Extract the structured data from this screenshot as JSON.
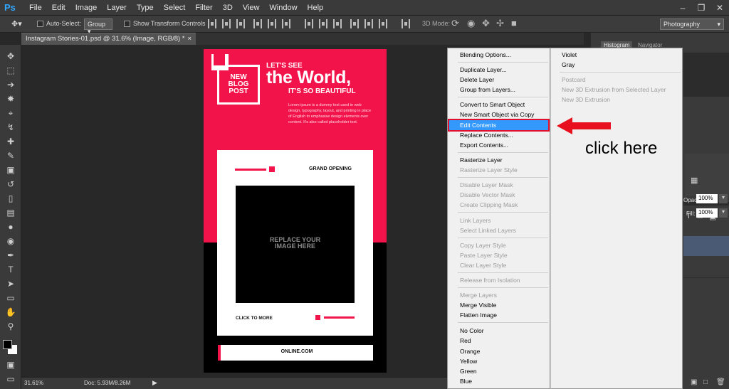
{
  "app": {
    "logo": "Ps"
  },
  "menu": [
    "File",
    "Edit",
    "Image",
    "Layer",
    "Type",
    "Select",
    "Filter",
    "3D",
    "View",
    "Window",
    "Help"
  ],
  "options_bar": {
    "auto_select_label": "Auto-Select:",
    "auto_select_value": "Group",
    "transform_controls_label": "Show Transform Controls",
    "mode_3d_label": "3D Mode:",
    "workspace": "Photography"
  },
  "document": {
    "tab_title": "Instagram Stories-01.psd @ 31.6% (Image, RGB/8) *"
  },
  "poster": {
    "logo_lines": [
      "NEW",
      "BLOG",
      "POST"
    ],
    "headline_top": "LET'S SEE",
    "headline_main": "the World,",
    "headline_sub": "IT'S SO BEAUTIFUL",
    "body_copy": "Lorem ipsum is a dummy text used in web design, typography, layout, and printing in place of English to emphasise design elements over content. It's also called placeholder text.",
    "card_heading": "GRAND OPENING",
    "image_placeholder_1": "REPLACE YOUR",
    "image_placeholder_2": "IMAGE HERE",
    "cta": "CLICK TO MORE",
    "url": "ONLINE.COM",
    "accent_color": "#f2134a"
  },
  "status_bar": {
    "zoom": "31.61%",
    "doc_size": "Doc: 5.93M/8.26M"
  },
  "panels": {
    "tab_histogram": "Histogram",
    "tab_navigator": "Navigator",
    "opacity_label": "Opacity:",
    "opacity_value": "100%",
    "fill_label": "Fill:",
    "fill_value": "100%"
  },
  "context_menu": {
    "items": [
      {
        "label": "Blending Options...",
        "enabled": true
      },
      {
        "label": "Duplicate Layer...",
        "enabled": true
      },
      {
        "label": "Delete Layer",
        "enabled": true
      },
      {
        "label": "Group from Layers...",
        "enabled": true
      },
      {
        "label": "Convert to Smart Object",
        "enabled": true
      },
      {
        "label": "New Smart Object via Copy",
        "enabled": true
      },
      {
        "label": "Edit Contents",
        "enabled": true,
        "highlighted": true
      },
      {
        "label": "Replace Contents...",
        "enabled": true
      },
      {
        "label": "Export Contents...",
        "enabled": true
      },
      {
        "label": "Rasterize Layer",
        "enabled": true
      },
      {
        "label": "Rasterize Layer Style",
        "enabled": false
      },
      {
        "label": "Disable Layer Mask",
        "enabled": false
      },
      {
        "label": "Disable Vector Mask",
        "enabled": false
      },
      {
        "label": "Create Clipping Mask",
        "enabled": false
      },
      {
        "label": "Link Layers",
        "enabled": false
      },
      {
        "label": "Select Linked Layers",
        "enabled": false
      },
      {
        "label": "Copy Layer Style",
        "enabled": false
      },
      {
        "label": "Paste Layer Style",
        "enabled": false
      },
      {
        "label": "Clear Layer Style",
        "enabled": false
      },
      {
        "label": "Release from Isolation",
        "enabled": false
      },
      {
        "label": "Merge Layers",
        "enabled": false
      },
      {
        "label": "Merge Visible",
        "enabled": true
      },
      {
        "label": "Flatten Image",
        "enabled": true
      },
      {
        "label": "No Color",
        "enabled": true
      },
      {
        "label": "Red",
        "enabled": true
      },
      {
        "label": "Orange",
        "enabled": true
      },
      {
        "label": "Yellow",
        "enabled": true
      },
      {
        "label": "Green",
        "enabled": true
      },
      {
        "label": "Blue",
        "enabled": true
      }
    ],
    "submenu": [
      {
        "label": "Violet",
        "enabled": true
      },
      {
        "label": "Gray",
        "enabled": true
      },
      {
        "label": "Postcard",
        "enabled": false
      },
      {
        "label": "New 3D Extrusion from Selected Layer",
        "enabled": false
      },
      {
        "label": "New 3D Extrusion",
        "enabled": false
      }
    ]
  },
  "annotation": {
    "text": "click here",
    "arrow_color": "#e8101f"
  }
}
